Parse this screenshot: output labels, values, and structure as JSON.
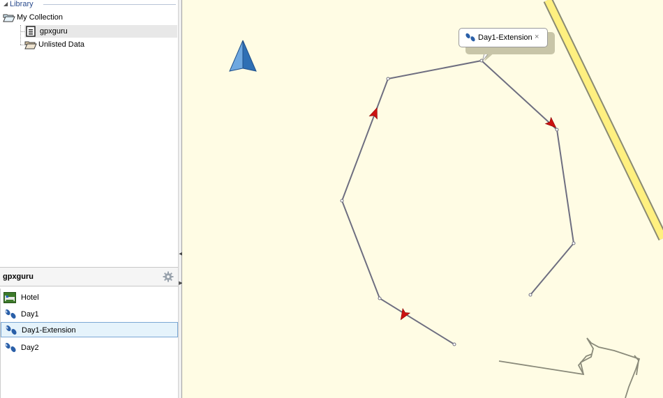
{
  "library": {
    "title": "Library",
    "items": [
      {
        "label": "My Collection",
        "icon": "folder-open-icon"
      },
      {
        "label": "gpxguru",
        "icon": "document-icon"
      },
      {
        "label": "Unlisted Data",
        "icon": "folder-open-icon"
      }
    ]
  },
  "panel": {
    "title": "gpxguru",
    "items": [
      {
        "label": "Hotel",
        "icon": "hotel-waypoint-icon"
      },
      {
        "label": "Day1",
        "icon": "footprints-icon"
      },
      {
        "label": "Day1-Extension",
        "icon": "footprints-icon",
        "selected": true
      },
      {
        "label": "Day2",
        "icon": "footprints-icon"
      }
    ]
  },
  "map": {
    "tooltip": {
      "label": "Day1-Extension",
      "close": "×"
    },
    "colors": {
      "background": "#fffce4",
      "road": "#fff080",
      "track": "#6e6e80",
      "arrow": "#cc1111",
      "north": "#2e6fb4"
    }
  }
}
